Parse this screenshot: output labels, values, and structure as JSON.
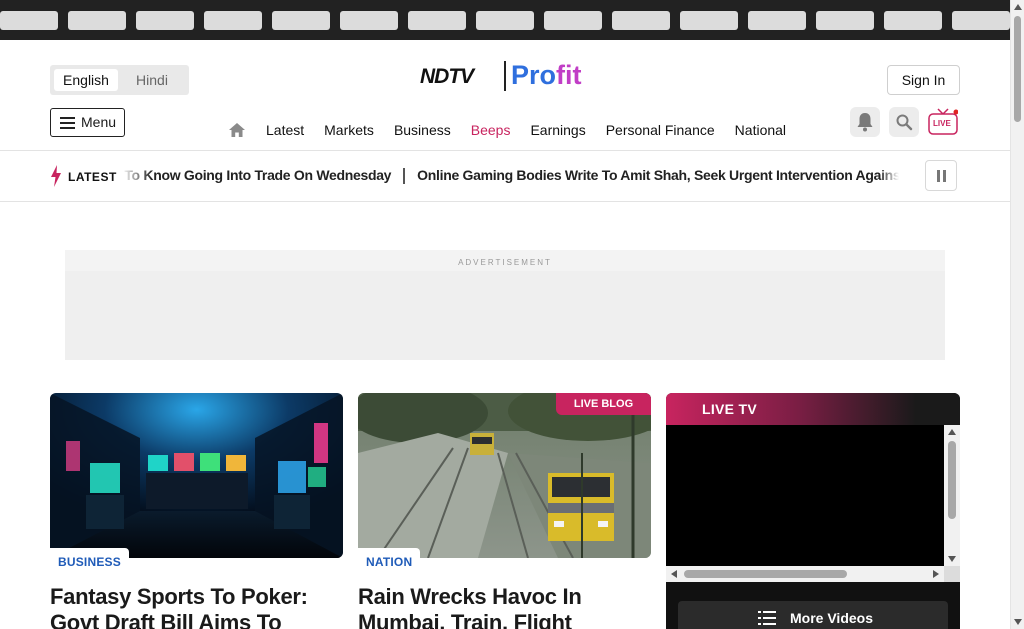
{
  "language": {
    "active": "English",
    "inactive": "Hindi"
  },
  "brand": {
    "logo_left": "NDTV",
    "logo_right_a": "Pro",
    "logo_right_b": "fit",
    "colors": {
      "blue": "#2f6fde",
      "purple": "#c13ec6",
      "accent": "#c8245f"
    }
  },
  "header": {
    "signin_label": "Sign In",
    "menu_label": "Menu",
    "nav": [
      {
        "label": "Latest"
      },
      {
        "label": "Markets"
      },
      {
        "label": "Business"
      },
      {
        "label": "Beeps"
      },
      {
        "label": "Earnings"
      },
      {
        "label": "Personal Finance"
      },
      {
        "label": "National"
      }
    ],
    "icons": [
      "home-icon",
      "bell-icon",
      "search-icon",
      "live-tv-icon"
    ],
    "live_badge": "LIVE"
  },
  "ticker": {
    "label": "LATEST",
    "items": [
      "ed To Know Going Into Trade On Wednesday",
      "Online Gaming Bodies Write To Amit Shah, Seek Urgent Intervention Agains"
    ]
  },
  "ad": {
    "label": "ADVERTISEMENT"
  },
  "cards": [
    {
      "category": "BUSINESS",
      "title": "Fantasy Sports To Poker: Govt Draft Bill Aims To"
    },
    {
      "badge": "LIVE BLOG",
      "category": "NATION",
      "title": "Rain Wrecks Havoc In Mumbai, Train, Flight"
    }
  ],
  "live_tv": {
    "title": "LIVE TV",
    "more_label": "More Videos"
  }
}
